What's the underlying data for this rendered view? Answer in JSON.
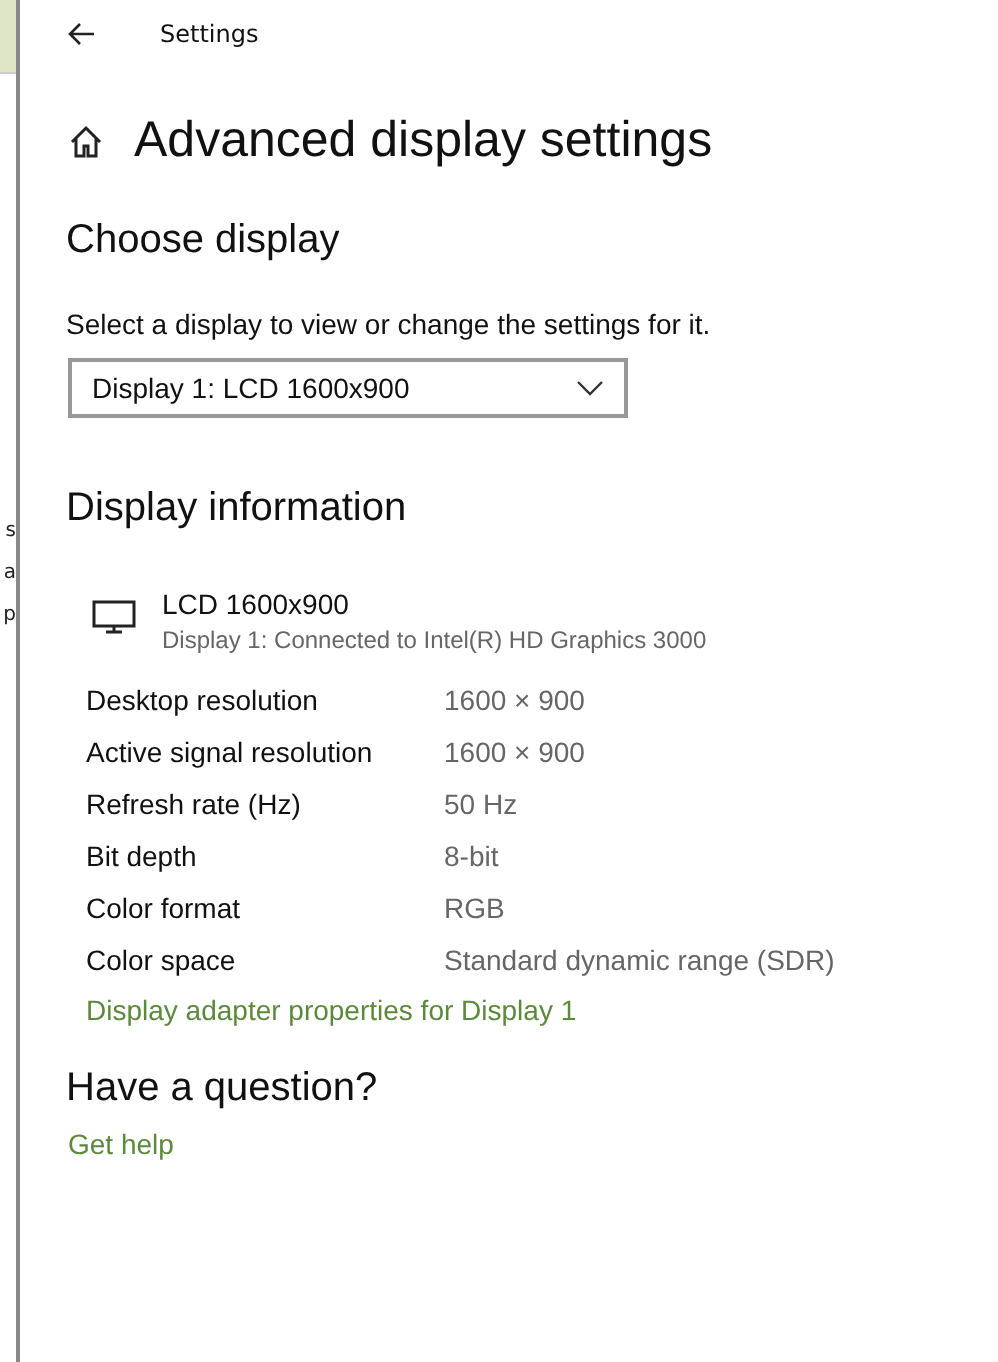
{
  "background_window": {
    "fragments": [
      "s",
      "a",
      "p"
    ]
  },
  "window": {
    "title": "Settings"
  },
  "page": {
    "title": "Advanced display settings"
  },
  "choose_display": {
    "heading": "Choose display",
    "description": "Select a display to view or change the settings for it.",
    "dropdown": {
      "value": "Display 1: LCD 1600x900"
    }
  },
  "display_information": {
    "heading": "Display information",
    "monitor": {
      "name": "LCD 1600x900",
      "detail": "Display 1: Connected to Intel(R) HD Graphics 3000"
    },
    "rows": [
      {
        "label": "Desktop resolution",
        "value": "1600 × 900"
      },
      {
        "label": "Active signal resolution",
        "value": "1600 × 900"
      },
      {
        "label": "Refresh rate (Hz)",
        "value": "50 Hz"
      },
      {
        "label": "Bit depth",
        "value": "8-bit"
      },
      {
        "label": "Color format",
        "value": "RGB"
      },
      {
        "label": "Color space",
        "value": "Standard dynamic range (SDR)"
      }
    ],
    "link": "Display adapter properties for Display 1"
  },
  "help": {
    "heading": "Have a question?",
    "link": "Get help"
  }
}
